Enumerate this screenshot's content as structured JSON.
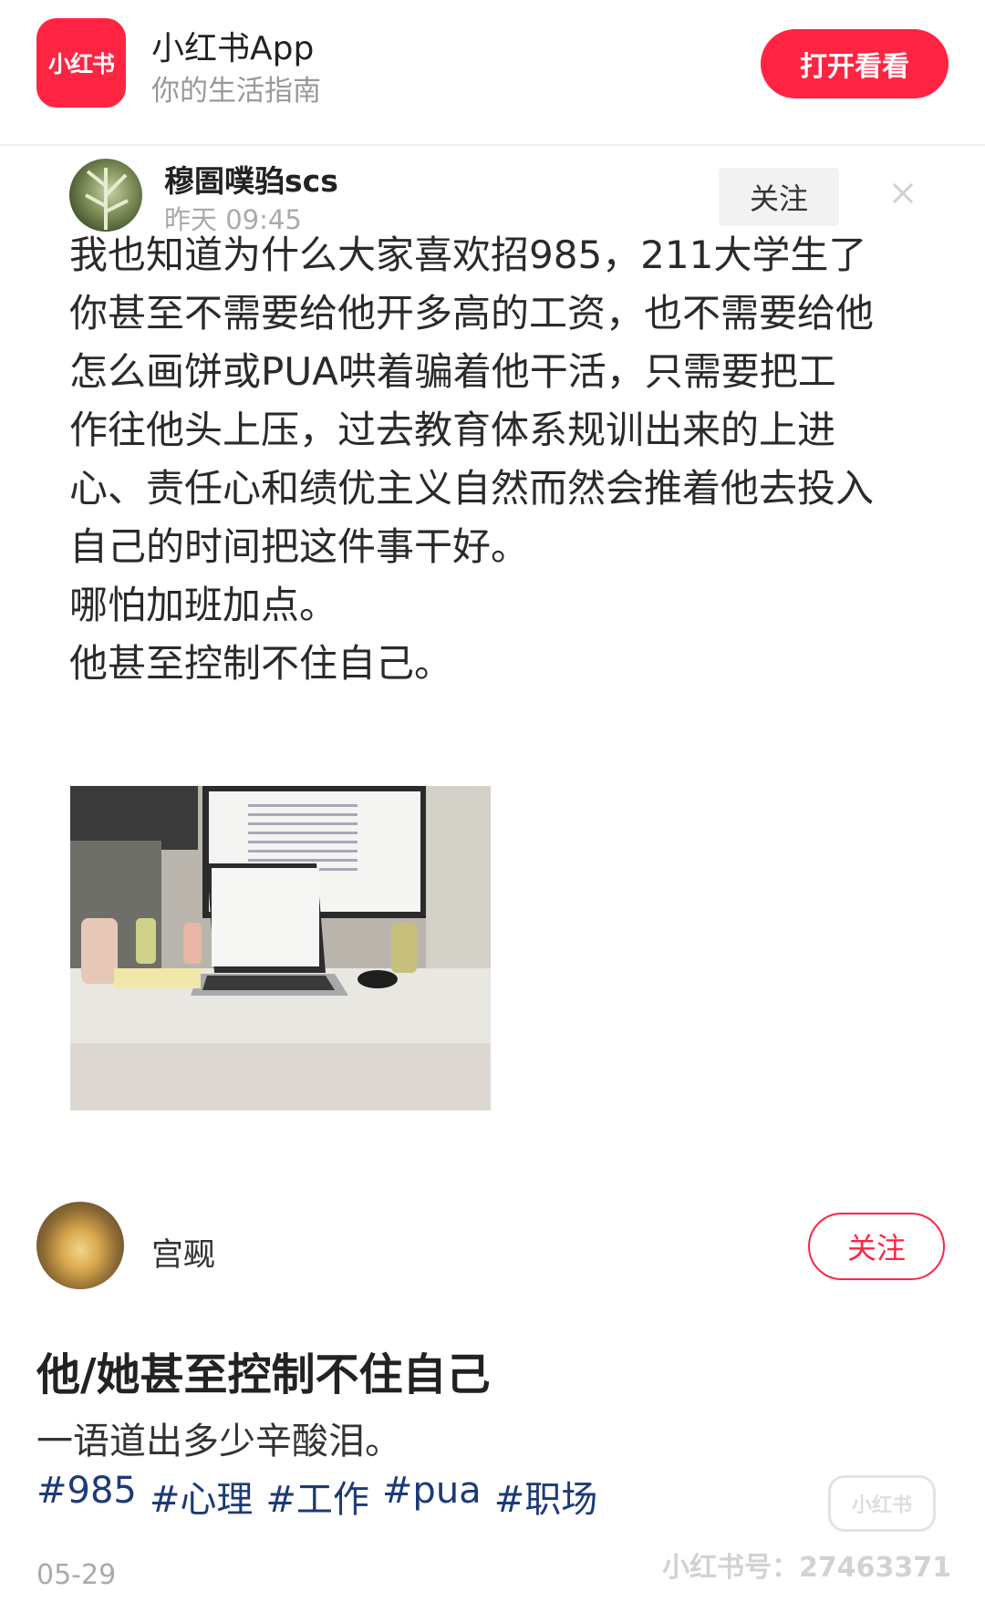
{
  "banner": {
    "logo_text": "小红书",
    "app_name": "小红书App",
    "slogan": "你的生活指南",
    "open_label": "打开看看"
  },
  "embedded_post": {
    "username": "穆圄噗驺scs",
    "time": "昨天 09:45",
    "follow_label": "关注",
    "lines": [
      "我也知道为什么大家喜欢招985，211大学生了",
      "你甚至不需要给他开多高的工资，也不需要给他",
      "怎么画饼或PUA哄着骗着他干活，只需要把工",
      "作往他头上压，过去教育体系规训出来的上进",
      "心、责任心和绩优主义自然而然会推着他去投入",
      "自己的时间把这件事干好。",
      "哪怕加班加点。",
      "他甚至控制不住自己。"
    ]
  },
  "post": {
    "author": "宫觋",
    "follow_label": "关注",
    "title": "他/她甚至控制不住自己",
    "description": "一语道出多少辛酸泪。",
    "tags": [
      "#985",
      "#心理",
      "#工作",
      "#pua",
      "#职场"
    ],
    "date": "05-29",
    "watermark": "小红书号：27463371"
  },
  "colors": {
    "brand": "#ff2442",
    "tag": "#1d3a78"
  }
}
